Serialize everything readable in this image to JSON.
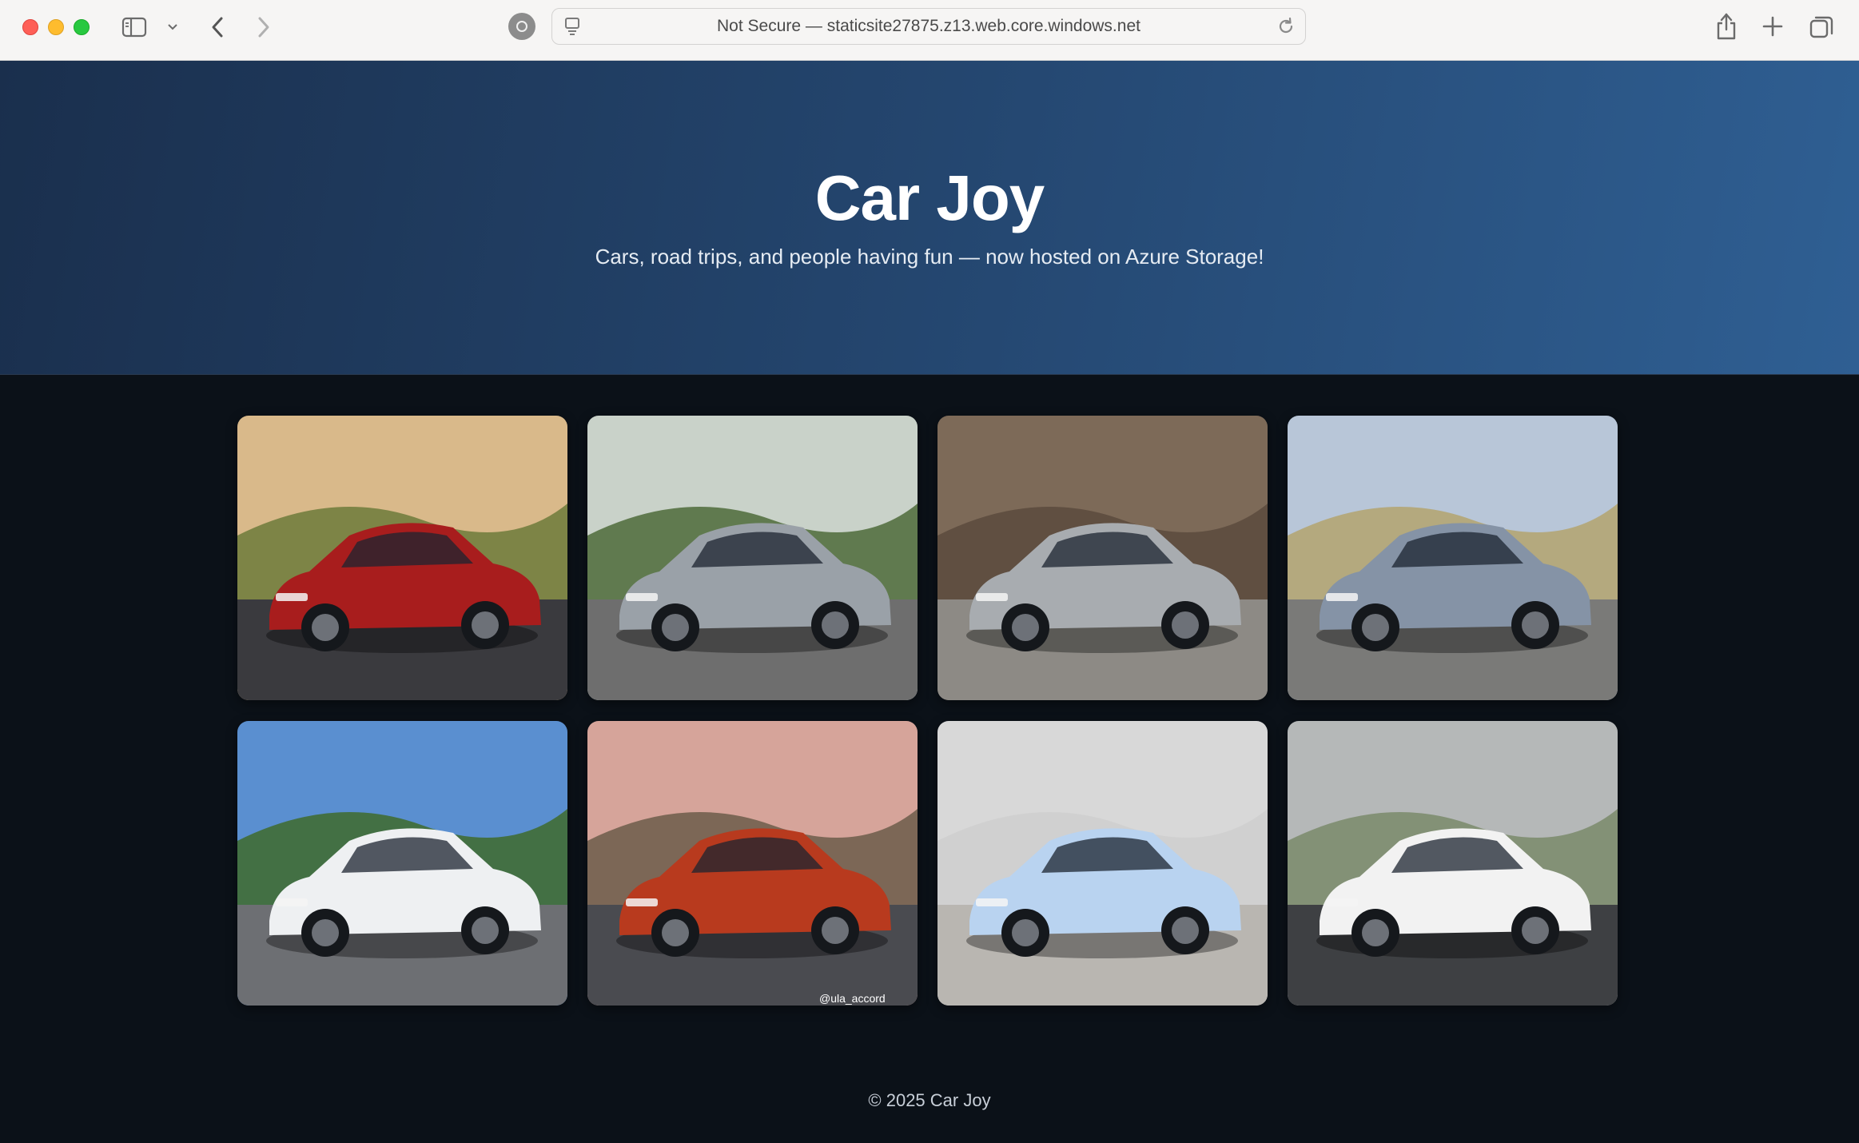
{
  "browser": {
    "url": "Not Secure — staticsite27875.z13.web.core.windows.net"
  },
  "hero": {
    "title": "Car Joy",
    "subtitle": "Cars, road trips, and people having fun — now hosted on Azure Storage!"
  },
  "gallery": {
    "photos": [
      {
        "name": "photo-red-skyline-r34",
        "sky": "#d9b98a",
        "ground": "#3a3a3e",
        "hill": "#6c7a3a",
        "car": "#a81d1d"
      },
      {
        "name": "photo-silver-civic-si",
        "sky": "#c9d2c9",
        "ground": "#6e6e6e",
        "hill": "#4d6b3a",
        "car": "#9aa1a8"
      },
      {
        "name": "photo-grey-bmw-m2",
        "sky": "#7d6a58",
        "ground": "#8d8a85",
        "hill": "#5a4a3d",
        "car": "#a8acb0"
      },
      {
        "name": "photo-grey-nissan-z-nismo",
        "sky": "#b8c6d8",
        "ground": "#7a7a78",
        "hill": "#b3a36e",
        "car": "#8593a6"
      },
      {
        "name": "photo-white-gtr-nismo",
        "sky": "#5a8fd0",
        "ground": "#6d6f73",
        "hill": "#3f6b2c",
        "car": "#eef0f2"
      },
      {
        "name": "photo-red-honda-accord",
        "sky": "#d6a49a",
        "ground": "#4a4b50",
        "hill": "#6c5d4a",
        "car": "#b83a1e"
      },
      {
        "name": "photo-blue-bmw-m2-showroom",
        "sky": "#d8d8d8",
        "ground": "#b9b6b1",
        "hill": "#cfcfcf",
        "car": "#b9d3f0"
      },
      {
        "name": "photo-type-r-parking-lot",
        "sky": "#b5b8b8",
        "ground": "#3e4043",
        "hill": "#7a8a6a",
        "car": "#f2f2f2"
      }
    ],
    "watermark": "@ula_accord"
  },
  "footer": {
    "text": "© 2025 Car Joy"
  }
}
